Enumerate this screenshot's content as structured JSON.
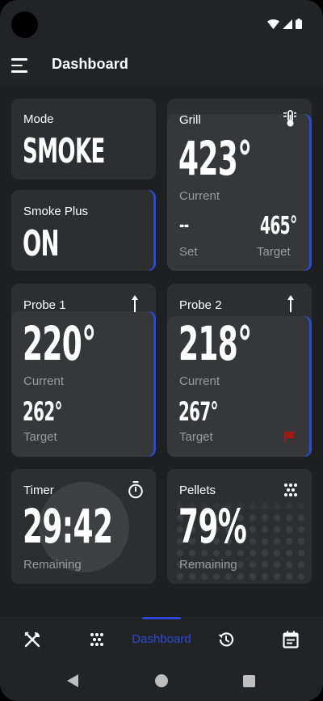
{
  "header": {
    "title": "Dashboard"
  },
  "cards": {
    "mode": {
      "label": "Mode",
      "value": "SMOKE"
    },
    "smoke_plus": {
      "label": "Smoke Plus",
      "value": "ON"
    },
    "grill": {
      "label": "Grill",
      "current_value": "423°",
      "current_label": "Current",
      "set_value": "--",
      "set_label": "Set",
      "target_value": "465°",
      "target_label": "Target",
      "icon": "thermometer-icon"
    },
    "probe1": {
      "label": "Probe 1",
      "current_value": "220°",
      "current_label": "Current",
      "target_value": "262°",
      "target_label": "Target",
      "icon": "probe-icon"
    },
    "probe2": {
      "label": "Probe 2",
      "current_value": "218°",
      "current_label": "Current",
      "target_value": "267°",
      "target_label": "Target",
      "icon": "probe-icon",
      "alert_icon": "flag-icon"
    },
    "timer": {
      "label": "Timer",
      "value": "29:42",
      "sub_label": "Remaining",
      "icon": "stopwatch-icon",
      "progress": 0.5
    },
    "pellets": {
      "label": "Pellets",
      "value": "79%",
      "sub_label": "Remaining",
      "icon": "pellets-icon",
      "level": 0.79
    }
  },
  "nav": {
    "items": [
      {
        "name": "recipes",
        "icon": "utensils-icon"
      },
      {
        "name": "pellets",
        "icon": "pellets-icon"
      },
      {
        "name": "dashboard",
        "label": "Dashboard",
        "active": true
      },
      {
        "name": "history",
        "icon": "history-icon"
      },
      {
        "name": "calendar",
        "icon": "calendar-icon"
      }
    ]
  },
  "colors": {
    "accent": "#2d47d6",
    "card": "#2d2e30",
    "card_inner": "#363739",
    "background": "#1e1f21",
    "flag": "#a01818"
  }
}
